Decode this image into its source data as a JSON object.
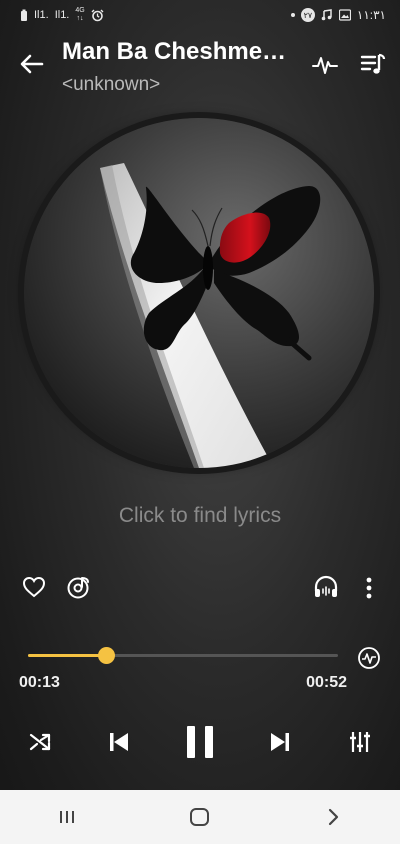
{
  "status_bar": {
    "left_signal_1": "Il1.",
    "left_signal_2": "Il1.",
    "network_top": "4G",
    "network_bottom": "↑↓",
    "right_badge": "۲۷",
    "time": "۱۱:۳۱"
  },
  "header": {
    "title": "Man Ba Cheshme…",
    "subtitle": "<unknown>"
  },
  "lyrics": {
    "label": "Click to find lyrics"
  },
  "progress": {
    "current": "00:13",
    "total": "00:52",
    "fraction": 0.25
  },
  "colors": {
    "accent": "#f5c242",
    "nav_bar": "#f4f4f4"
  },
  "icons": {
    "back": "arrow-left",
    "waveform": "audio-wave",
    "queue": "playlist-music",
    "favorite": "heart-outline",
    "ringtone": "disc-note",
    "headphones": "headphones-wave",
    "more": "dots-vertical",
    "speed": "playback-speed",
    "shuffle": "shuffle",
    "previous": "skip-previous",
    "pause": "pause",
    "next": "skip-next",
    "equalizer": "equalizer-sliders",
    "recent_apps": "recent-apps",
    "home": "home",
    "nav_back": "back"
  }
}
